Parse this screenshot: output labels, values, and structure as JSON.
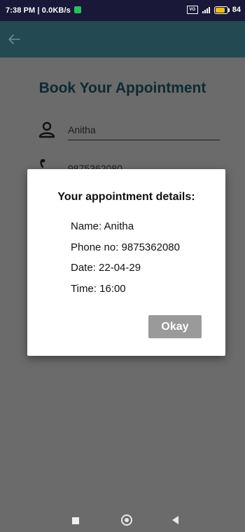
{
  "status_bar": {
    "time": "7:38 PM",
    "speed": "0.0KB/s",
    "battery": "84"
  },
  "app_bar": {
    "back_icon": "arrow-left-icon"
  },
  "form": {
    "title": "Book Your Appointment",
    "name_value": "Anitha",
    "phone_value": "9875362080"
  },
  "dialog": {
    "title": "Your appointment details:",
    "name": "Name: Anitha",
    "phone": "Phone no: 9875362080",
    "date": "Date: 22-04-29",
    "time": "Time: 16:00",
    "okay_label": "Okay"
  },
  "colors": {
    "status_bar": "#1a1838",
    "app_bar": "#234a52",
    "scrim": "#6b6b6b",
    "button": "#9a9a9a"
  }
}
